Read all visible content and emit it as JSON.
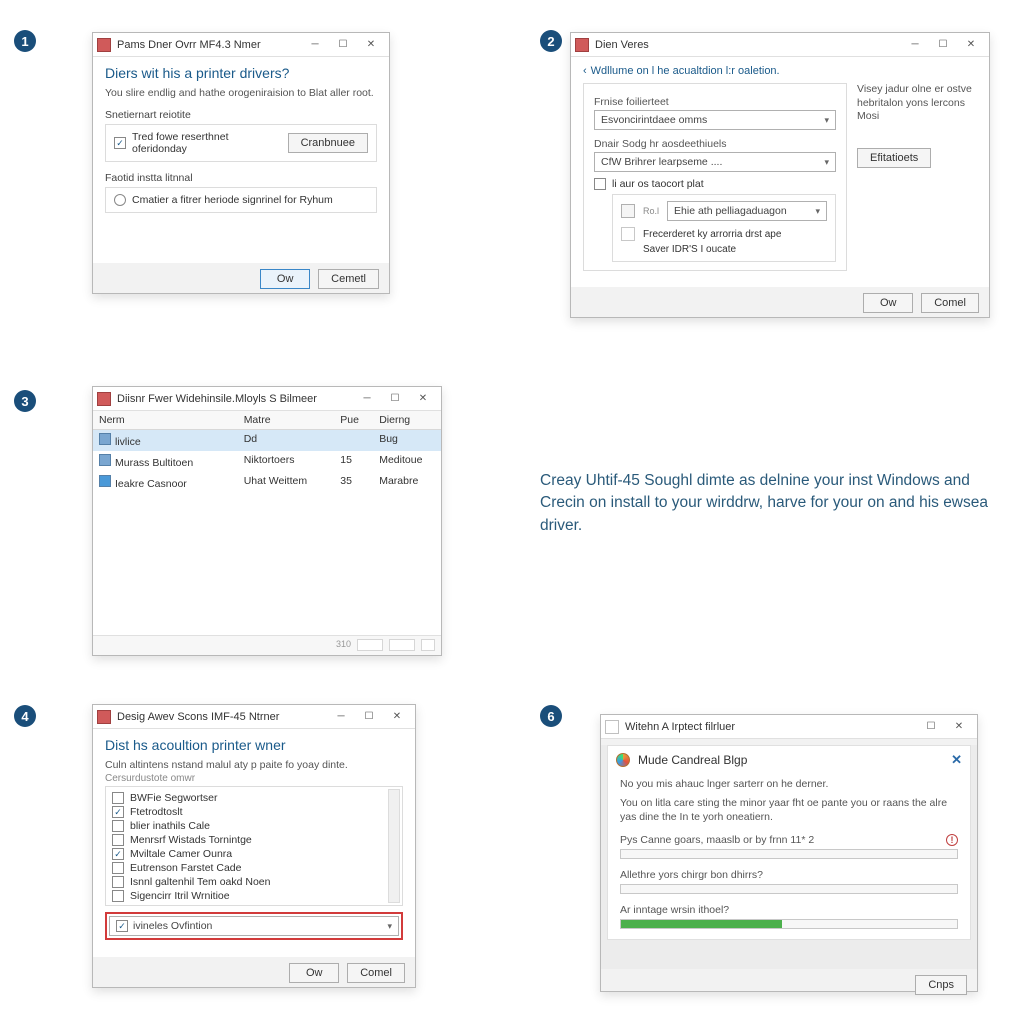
{
  "badges": {
    "s1": "1",
    "s2": "2",
    "s3": "3",
    "s4": "4",
    "s6": "6"
  },
  "step1": {
    "title": "Pams Dner Ovrr MF4.3 Nmer",
    "heading": "Diers wit his a printer drivers?",
    "sub": "You slire endlig and hathe orogeniraision to Blat aller root.",
    "section1_label": "Snetiernart reiotite",
    "chk1_label": "Tred fowe reserthnet oferidonday",
    "browse_btn": "Cranbnuee",
    "section2_label": "Faotid instta litnnal",
    "radio_label": "Cmatier a fitrer heriode signrinel for Ryhum",
    "ok": "Ow",
    "cancel": "Cemetl"
  },
  "step2": {
    "title": "Dien Veres",
    "back": "Wdllume on l he acualtdion l:r oaletion.",
    "right_note": "Visey jadur olne er ostve\nhebritalon yons lercons Mosi",
    "right_btn": "Efitatioets",
    "f1_label": "Frnise foilierteet",
    "f1_value": "Esvoncirintdaee omms",
    "f2_label": "Dnair Sodg hr aosdeethiuels",
    "f2_value": "CfW Brihrer learpseme ....",
    "subchk": "li aur os taocort plat",
    "sub_dd": "Ehie ath pelliagaduagon",
    "sub_item1": "Frecerderet ky arrorria drst ape",
    "sub_item2": "Saver IDR'S I oucate",
    "ok": "Ow",
    "cancel": "Comel"
  },
  "step3": {
    "title": "Diisnr Fwer Widehinsile.Mloyls S Bilmeer",
    "cols": {
      "name": "Nerm",
      "b": "Matre",
      "c": "Pue",
      "d": "Dierng"
    },
    "rows": [
      {
        "name": "livlice",
        "b": "Dd",
        "c": "",
        "d": "Bug"
      },
      {
        "name": "Murass Bultitoen",
        "b": "Niktortoers",
        "c": "15",
        "d": "Meditoue"
      },
      {
        "name": "Ieakre Casnoor",
        "b": "Uhat Weittem",
        "c": "35",
        "d": "Marabre"
      }
    ]
  },
  "step4": {
    "title": "Desig Awev Scons IMF-45 Ntrner",
    "heading": "Dist hs acoultion printer wner",
    "sub": "Culn altintens nstand malul aty p paite fo yoay dinte.",
    "list_caption": "Cersurdustote omwr",
    "items": [
      {
        "chk": false,
        "label": "BWFie Segwortser"
      },
      {
        "chk": true,
        "label": "Ftetrodtoslt"
      },
      {
        "chk": false,
        "label": "blier inathils Cale"
      },
      {
        "chk": false,
        "label": "Menrsrf Wistads Tornintge"
      },
      {
        "chk": true,
        "label": "Mviltale Camer Ounra"
      },
      {
        "chk": false,
        "label": "Eutrenson Farstet Cade"
      },
      {
        "chk": false,
        "label": "Isnnl galtenhil Tem oakd Noen"
      },
      {
        "chk": false,
        "label": "Sigencirr Itril Wrnitioe"
      }
    ],
    "dd_label": "ivineles Ovfintion",
    "ok": "Ow",
    "cancel": "Comel"
  },
  "step5": {
    "text": "Creay Uhtif-45 Soughl dimte as delnine your inst Windows and Crecin on install to your wirddrw, harve for your on and his ewsea driver."
  },
  "step6": {
    "title": "Witehn A Irptect filrluer",
    "card_title": "Mude Candreal Blgp",
    "line1": "No you mis ahauc lnger sarterr on he derner.",
    "line2": "You on litla care sting the minor yaar fht oe pante you or raans the alre yas dine the In te yorh oneatiern.",
    "row_a": "Pys Canne goars, maaslb or by frnn 11* 2",
    "row_b": "Allethre yors chirgr bon dhirrs?",
    "row_c": "Ar inntage wrsin ithoel?",
    "progress_pct": 48,
    "ok": "Cnps"
  }
}
